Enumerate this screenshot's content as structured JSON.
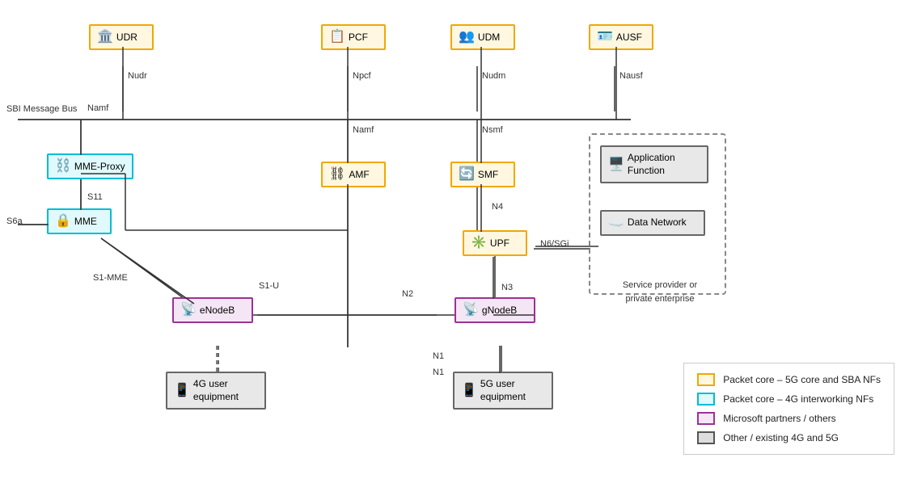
{
  "nodes": {
    "udr": {
      "label": "UDR",
      "type": "yellow"
    },
    "pcf": {
      "label": "PCF",
      "type": "yellow"
    },
    "udm": {
      "label": "UDM",
      "type": "yellow"
    },
    "ausf": {
      "label": "AUSF",
      "type": "yellow"
    },
    "amf": {
      "label": "AMF",
      "type": "yellow"
    },
    "smf": {
      "label": "SMF",
      "type": "yellow"
    },
    "upf": {
      "label": "UPF",
      "type": "yellow"
    },
    "mme_proxy": {
      "label": "MME-Proxy",
      "type": "cyan"
    },
    "mme": {
      "label": "MME",
      "type": "cyan"
    },
    "enodeb": {
      "label": "eNodeB",
      "type": "purple"
    },
    "gnodeb": {
      "label": "gNodeB",
      "type": "purple"
    },
    "ue4g": {
      "label": "4G user equipment",
      "type": "gray"
    },
    "ue5g": {
      "label": "5G user equipment",
      "type": "gray"
    },
    "af": {
      "label": "Application Function",
      "type": "gray"
    },
    "dn": {
      "label": "Data Network",
      "type": "gray"
    }
  },
  "labels": {
    "nudr": "Nudr",
    "npcf": "Npcf",
    "nudm": "Nudm",
    "nausf": "Nausf",
    "namf_udr": "Namf",
    "namf_amf": "Namf",
    "nsmf": "Nsmf",
    "sbi": "SBI Message Bus",
    "s11": "S11",
    "s6a": "S6a",
    "s1mme": "S1-MME",
    "s1u": "S1-U",
    "n2": "N2",
    "n4": "N4",
    "n3": "N3",
    "n6sgi": "N6/SGi",
    "n1_top": "N1",
    "n1_bot": "N1",
    "service_provider": "Service provider or\nprivate enterprise"
  },
  "legend": {
    "items": [
      {
        "color": "yellow",
        "text": "Packet core – 5G core and SBA NFs"
      },
      {
        "color": "cyan",
        "text": "Packet core – 4G interworking NFs"
      },
      {
        "color": "purple",
        "text": "Microsoft partners / others"
      },
      {
        "color": "gray",
        "text": "Other / existing 4G and 5G"
      }
    ]
  }
}
